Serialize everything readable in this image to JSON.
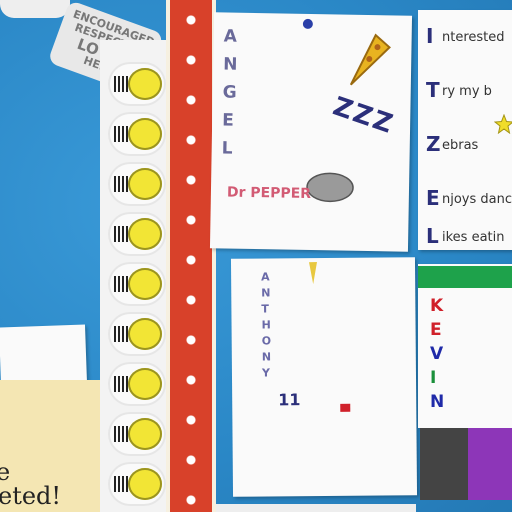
{
  "sticker": {
    "lines": [
      "ENCOURAGED",
      "RESPECTED",
      "LOVED",
      "HERE"
    ]
  },
  "angel_card": {
    "letters": [
      "A",
      "N",
      "G",
      "E",
      "L"
    ],
    "sleep_text": "ZZZ",
    "drawing_caption": "Dr PEPPER"
  },
  "kid_card": {
    "letters": [
      "I",
      "T",
      "Z",
      "E",
      "L"
    ],
    "lines": [
      "nterested",
      "ry my b",
      "ebras",
      "njoys danc",
      "ikes eatin"
    ]
  },
  "anthony_card": {
    "letters": [
      "A",
      "N",
      "T",
      "H",
      "O",
      "N",
      "Y"
    ],
    "number": "11"
  },
  "kevin_card": {
    "letters": [
      "K",
      "E",
      "V",
      "I",
      "N"
    ],
    "colors": [
      "#d0202a",
      "#d0202a",
      "#1f2aa8",
      "#1a8f3a",
      "#1f2aa8"
    ]
  },
  "yellow_card": {
    "lines": [
      "e",
      "eted!"
    ]
  }
}
